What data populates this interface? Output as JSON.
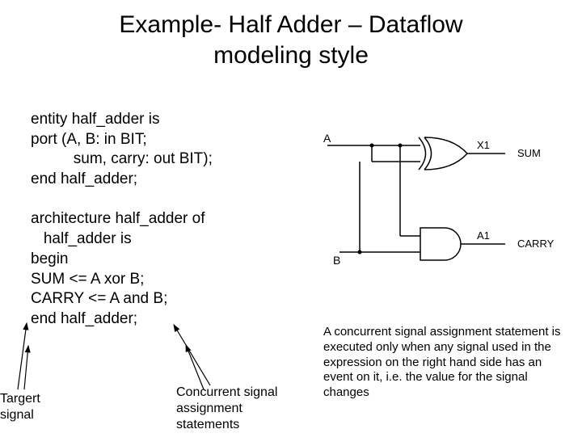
{
  "title_line1": "Example- Half Adder – Dataflow",
  "title_line2": "modeling style",
  "code_block": "entity half_adder is\nport (A, B: in BIT;\n          sum, carry: out BIT);\nend half_adder;\n\narchitecture half_adder of\n   half_adder is\nbegin\nSUM <= A xor B;\nCARRY <= A and B;\nend half_adder;",
  "diagram": {
    "input_a": "A",
    "input_b": "B",
    "gate_xor": "X1",
    "gate_and": "A1",
    "out_sum": "SUM",
    "out_carry": "CARRY"
  },
  "note_text": "A concurrent signal assignment statement is executed only when any signal used in the expression on the right hand side has an event on it, i.e. the value for the signal changes",
  "label_target_l1": "Targert",
  "label_target_l2": "signal",
  "label_concurrent_l1": "Concurrent signal",
  "label_concurrent_l2": "assignment",
  "label_concurrent_l3": "statements"
}
